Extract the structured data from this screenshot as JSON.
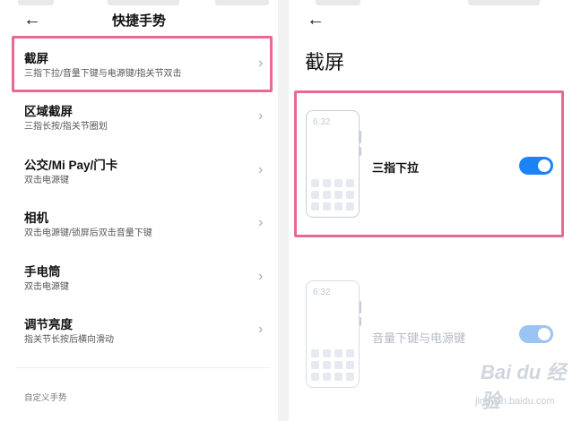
{
  "left": {
    "title": "快捷手势",
    "back_glyph": "←",
    "items": [
      {
        "title": "截屏",
        "sub": "三指下拉/音量下键与电源键/指关节双击"
      },
      {
        "title": "区域截屏",
        "sub": "三指长按/指关节圈划"
      },
      {
        "title": "公交/Mi Pay/门卡",
        "sub": "双击电源键"
      },
      {
        "title": "相机",
        "sub": "双击电源键/锁屏后双击音量下键"
      },
      {
        "title": "手电筒",
        "sub": "双击电源键"
      },
      {
        "title": "调节亮度",
        "sub": "指关节长按后横向滑动"
      }
    ],
    "section_label": "自定义手势",
    "chevron_glyph": "›"
  },
  "right": {
    "back_glyph": "←",
    "title": "截屏",
    "options": [
      {
        "label": "三指下拉",
        "enabled": true,
        "time": "6:32"
      },
      {
        "label": "音量下键与电源键",
        "enabled": true,
        "time": "6:32"
      }
    ]
  },
  "watermark": {
    "text": "Bai du 经验",
    "sub": "jingyan.baidu.com"
  },
  "colors": {
    "accent": "#1b82f8",
    "highlight": "#e66a93"
  },
  "icons": [
    "back-arrow-icon",
    "chevron-right-icon",
    "toggle-switch-icon",
    "phone-illustration-icon"
  ]
}
